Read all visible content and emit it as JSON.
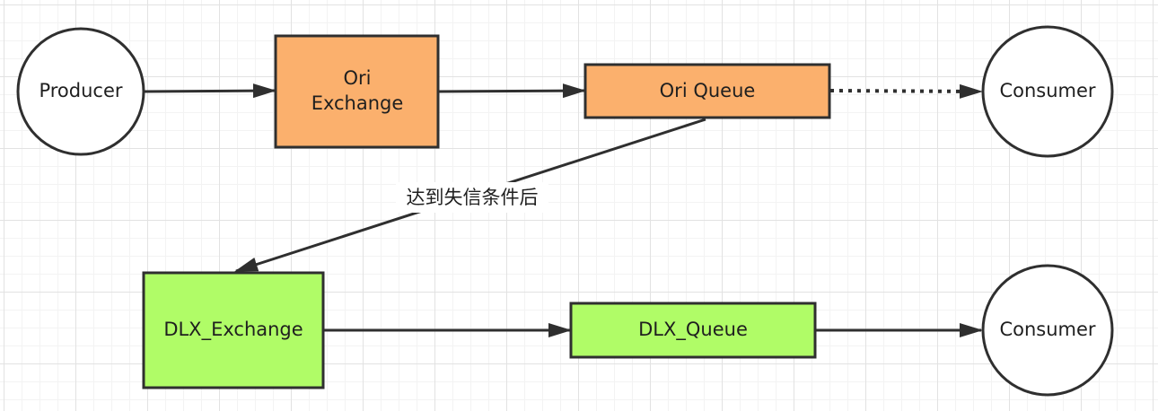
{
  "colors": {
    "orange_fill": "#fbb06d",
    "green_fill": "#b0fc67",
    "stroke": "#2f2f2f",
    "circle_fill": "#ffffff"
  },
  "nodes": {
    "producer": "Producer",
    "ori_exchange_line1": "Ori",
    "ori_exchange_line2": "Exchange",
    "ori_queue": "Ori Queue",
    "consumer_top": "Consumer",
    "dlx_exchange": "DLX_Exchange",
    "dlx_queue": "DLX_Queue",
    "consumer_bottom": "Consumer"
  },
  "edges": {
    "dead_letter_label": "达到失信条件后"
  }
}
